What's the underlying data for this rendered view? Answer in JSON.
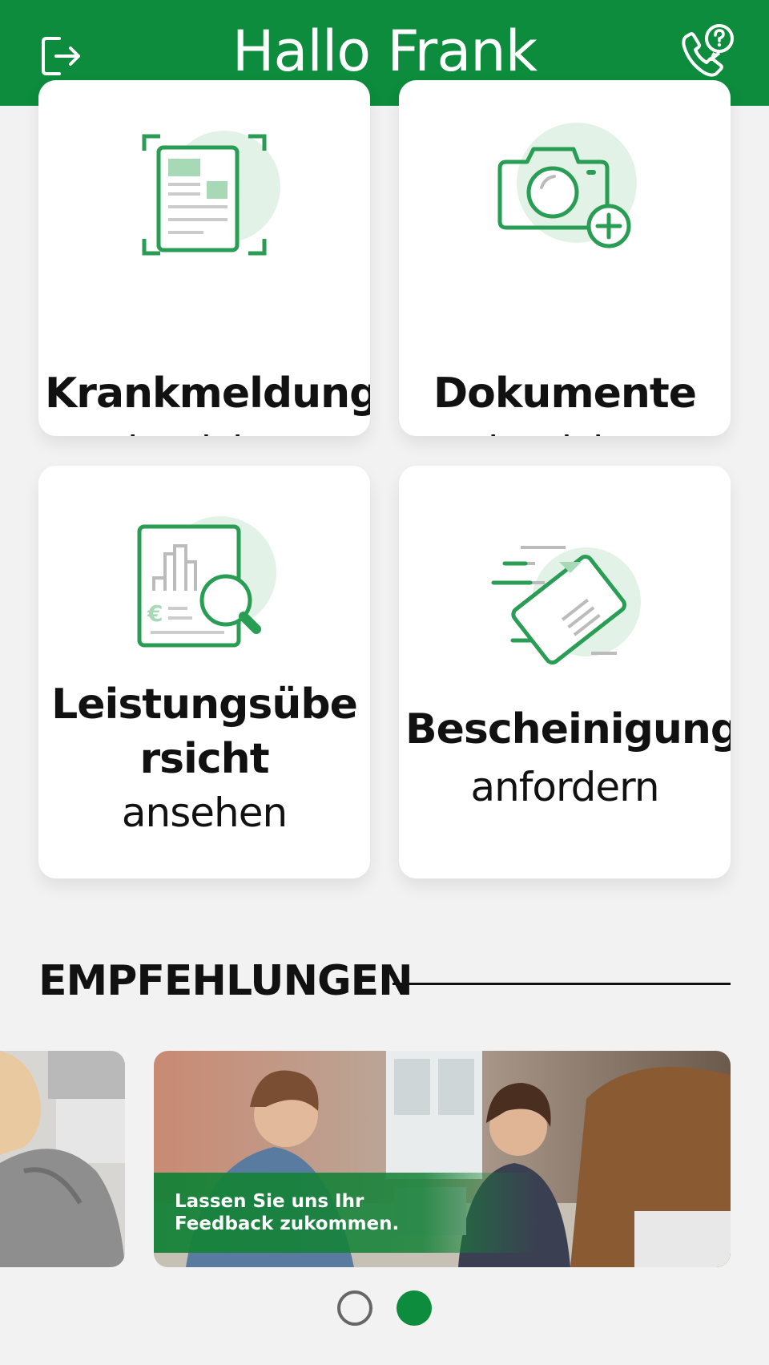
{
  "header": {
    "title": "Hallo Frank",
    "logout_icon": "logout-icon",
    "phone_icon": "phone-help-icon"
  },
  "tiles": [
    {
      "title": "Krankmeldung",
      "subtitle": "einreichen",
      "icon": "document-scan-icon"
    },
    {
      "title": "Dokumente",
      "subtitle": "einreichen",
      "icon": "camera-add-icon"
    },
    {
      "title": "Leistungsübersicht",
      "subtitle": "ansehen",
      "icon": "report-search-icon"
    },
    {
      "title": "Bescheinigung",
      "subtitle": "anfordern",
      "icon": "certificate-send-icon"
    }
  ],
  "recommendations": {
    "heading": "EMPFEHLUNGEN",
    "banners": [
      {
        "caption": ""
      },
      {
        "caption_line1": "Lassen Sie uns Ihr",
        "caption_line2": "Feedback zukommen."
      }
    ],
    "pagination": {
      "count": 2,
      "active": 1
    }
  },
  "colors": {
    "brand_green": "#0c8c3c",
    "icon_green": "#2a9d55",
    "icon_light": "#e3f2e7",
    "background": "#f2f2f2"
  }
}
